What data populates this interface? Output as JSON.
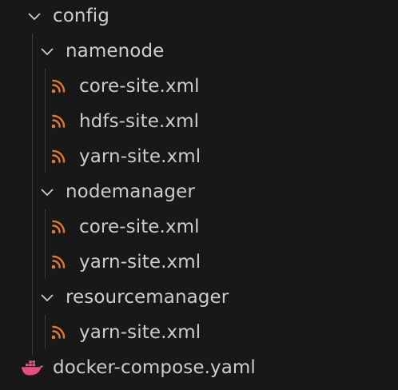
{
  "colors": {
    "background": "#181818",
    "text": "#cccccc",
    "rss_icon": "#e37933",
    "docker_icon": "#e64e83",
    "indent_guide": "#3a3a3a"
  },
  "tree": {
    "config": {
      "label": "config",
      "icon": "chevron-down-icon"
    },
    "namenode": {
      "label": "namenode",
      "icon": "chevron-down-icon",
      "files": [
        "core-site.xml",
        "hdfs-site.xml",
        "yarn-site.xml"
      ]
    },
    "nodemanager": {
      "label": "nodemanager",
      "icon": "chevron-down-icon",
      "files": [
        "core-site.xml",
        "yarn-site.xml"
      ]
    },
    "resourcemanager": {
      "label": "resourcemanager",
      "icon": "chevron-down-icon",
      "files": [
        "yarn-site.xml"
      ]
    },
    "docker_compose": {
      "label": "docker-compose.yaml",
      "icon": "docker-icon"
    },
    "file_icon": "rss-icon"
  }
}
